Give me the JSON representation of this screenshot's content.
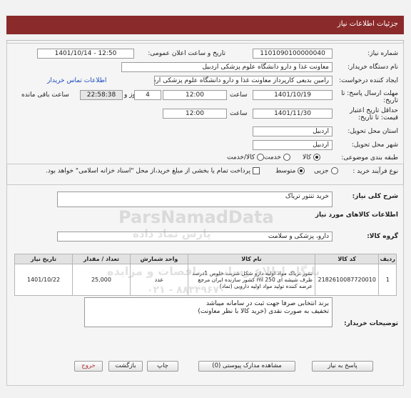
{
  "header": {
    "title": "جزئیات اطلاعات نیاز"
  },
  "need_number": {
    "label": "شماره نیاز:",
    "value": "1101090100000040"
  },
  "announce": {
    "label": "تاریخ و ساعت اعلان عمومی:",
    "value": "1401/10/14 - 12:50"
  },
  "buyer_org": {
    "label": "نام دستگاه خریدار:",
    "value": "معاونت غذا و دارو دانشگاه علوم پزشکی اردبیل"
  },
  "requester": {
    "label": "ایجاد کننده درخواست:",
    "value": "رامین  بدیعی  کارپرداز  معاونت غذا و دارو دانشگاه علوم پزشکی اردبیل",
    "contact_link": "اطلاعات تماس خریدار"
  },
  "deadline": {
    "label": "مهلت ارسال پاسخ: تا تاریخ:",
    "date": "1401/10/19",
    "time_label": "ساعت",
    "time": "12:00",
    "days": "4",
    "days_label": "روز و",
    "remaining": "22:58:38",
    "remaining_label": "ساعت باقی مانده"
  },
  "validity": {
    "label": "حداقل تاریخ اعتبار قیمت: تا تاریخ:",
    "date": "1401/11/30",
    "time_label": "ساعت",
    "time": "12:00"
  },
  "province": {
    "label": "استان محل تحویل:",
    "value": "اردبیل"
  },
  "city": {
    "label": "شهر محل تحویل:",
    "value": "اردبیل"
  },
  "category": {
    "label": "طبقه بندی موضوعی:",
    "options": [
      "کالا",
      "خدمت",
      "کالا/خدمت"
    ],
    "selected": 0
  },
  "process": {
    "label": "نوع فرآیند خرید :",
    "options": [
      "جزیی",
      "متوسط"
    ],
    "selected": 1,
    "payment_note": "پرداخت تمام یا بخشی از مبلغ خرید،از محل \"اسناد خزانه اسلامی\" خواهد بود."
  },
  "summary": {
    "label": "شرح کلی نیاز:",
    "value": "خرید تنتور تریاک"
  },
  "items_title": "اطلاعات کالاهای مورد نیاز",
  "goods_group": {
    "label": "گروه کالا:",
    "value": "دارو، پزشکی و سلامت"
  },
  "table": {
    "headers": [
      "ردیف",
      "کد کالا",
      "نام کالا",
      "واحد شمارش",
      "تعداد / مقدار",
      "تاریخ نیاز"
    ],
    "rows": [
      {
        "row": "1",
        "code": "2182610087720010",
        "name": "تنتور تریاک مواد اولیه دارو شکل شربت خلوص 1درصد ظرف شیشه ای 250 ml کشور سازنده ایران مرجع عرضه کننده تولید مواد اولیه دارویی (تماد)",
        "unit": "عدد",
        "qty": "25,000",
        "date": "1401/10/22"
      }
    ]
  },
  "buyer_notes": {
    "label": "توضیحات خریدار:",
    "line1": "برند انتخابی صرفا جهت ثبت در سامانه میباشد",
    "line2": "تخفیف به صورت نقدی (خرید کالا با نظر معاونت)"
  },
  "buttons": {
    "reply": "پاسخ به نیاز",
    "view_docs": "مشاهده مدارک پیوستی (0)",
    "print": "چاپ",
    "back": "بازگشت",
    "exit": "خروج"
  },
  "watermark": {
    "brand": "ParsNamadData",
    "fa1": "پایگاه اطلاع رسانی مناقصات و مزایده",
    "fa2": "پارس نماد داده",
    "phone": "۰۲۱ - ۸۸۳۴۹۶۷۰"
  },
  "colors": {
    "header": "#8b2a2a",
    "link": "#1a4bbf",
    "exit_btn": "#b03030"
  }
}
